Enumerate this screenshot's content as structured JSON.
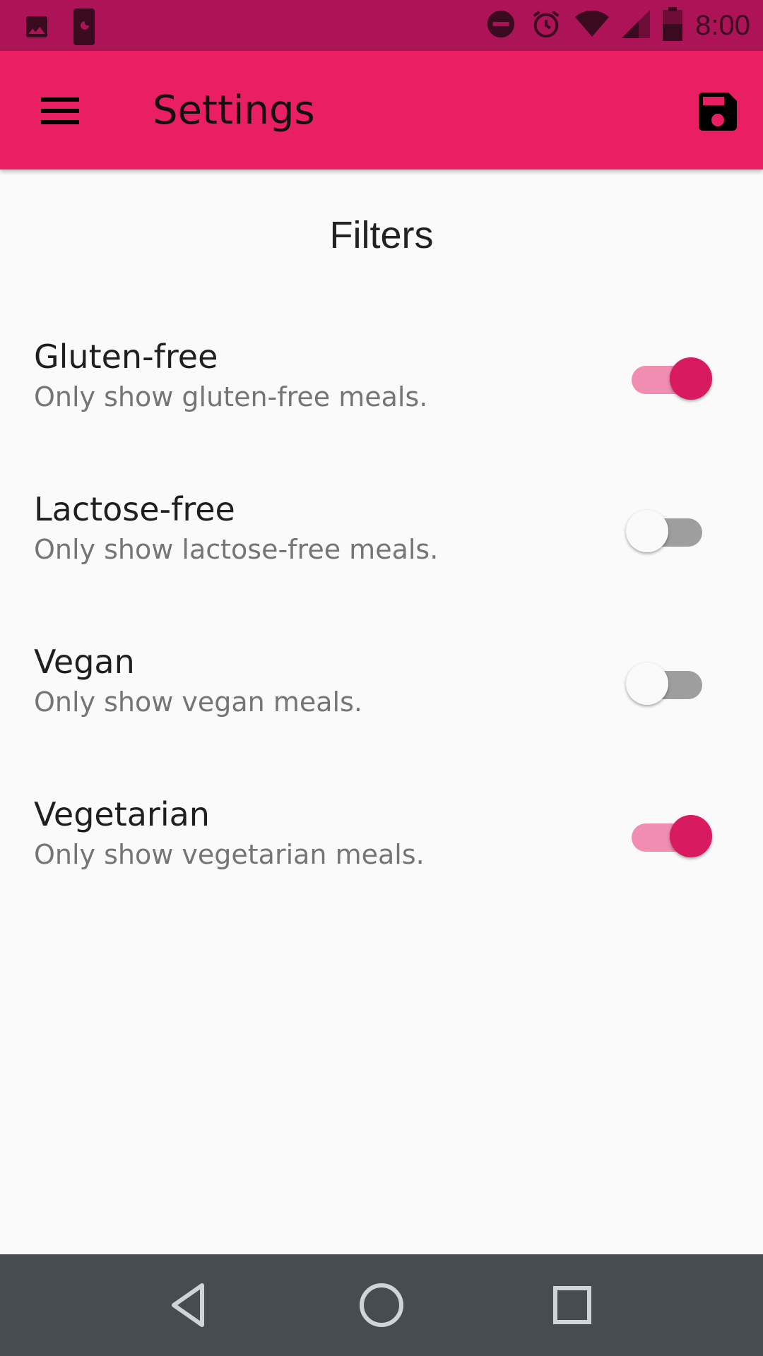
{
  "status_bar": {
    "time": "8:00",
    "icons": [
      "image-icon",
      "phone-moon-icon",
      "do-not-disturb-icon",
      "alarm-icon",
      "wifi-icon",
      "signal-icon",
      "battery-icon"
    ]
  },
  "app_bar": {
    "title": "Settings",
    "menu_icon": "hamburger-menu-icon",
    "save_icon": "save-floppy-icon"
  },
  "filters": {
    "title": "Filters",
    "items": [
      {
        "label": "Gluten-free",
        "description": "Only show gluten-free meals.",
        "enabled": true
      },
      {
        "label": "Lactose-free",
        "description": "Only show lactose-free meals.",
        "enabled": false
      },
      {
        "label": "Vegan",
        "description": "Only show vegan meals.",
        "enabled": false
      },
      {
        "label": "Vegetarian",
        "description": "Only show vegetarian meals.",
        "enabled": true
      }
    ]
  },
  "nav_bar": {
    "icons": [
      "back-icon",
      "home-icon",
      "recents-icon"
    ]
  },
  "colors": {
    "status_bar": "#ad1457",
    "app_bar": "#e91e63",
    "switch_on_thumb": "#d81b60",
    "switch_on_track": "#f08db1",
    "background": "#fafafa",
    "nav_bar": "#454c52"
  }
}
